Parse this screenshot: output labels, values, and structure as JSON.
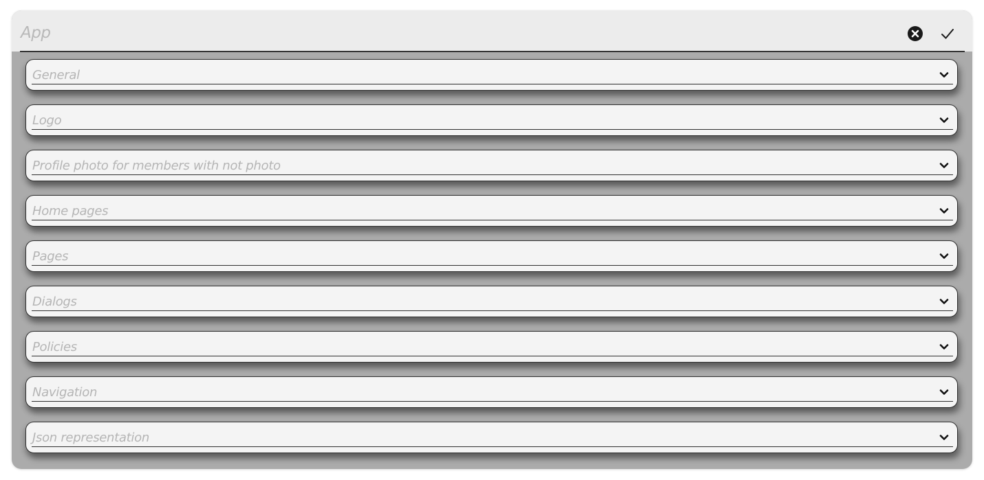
{
  "dialog": {
    "title": "App",
    "close_icon": "close-circle-icon",
    "confirm_icon": "check-icon"
  },
  "sections": [
    {
      "label": "General"
    },
    {
      "label": "Logo"
    },
    {
      "label": "Profile photo for members with not photo"
    },
    {
      "label": "Home pages"
    },
    {
      "label": "Pages"
    },
    {
      "label": "Dialogs"
    },
    {
      "label": "Policies"
    },
    {
      "label": "Navigation"
    },
    {
      "label": "Json representation"
    }
  ],
  "colors": {
    "header_bg": "#ececec",
    "body_bg": "#ababab",
    "section_bg": "#f4f4f4",
    "label_color": "#b5b5b5",
    "border": "#2e2e2e"
  }
}
